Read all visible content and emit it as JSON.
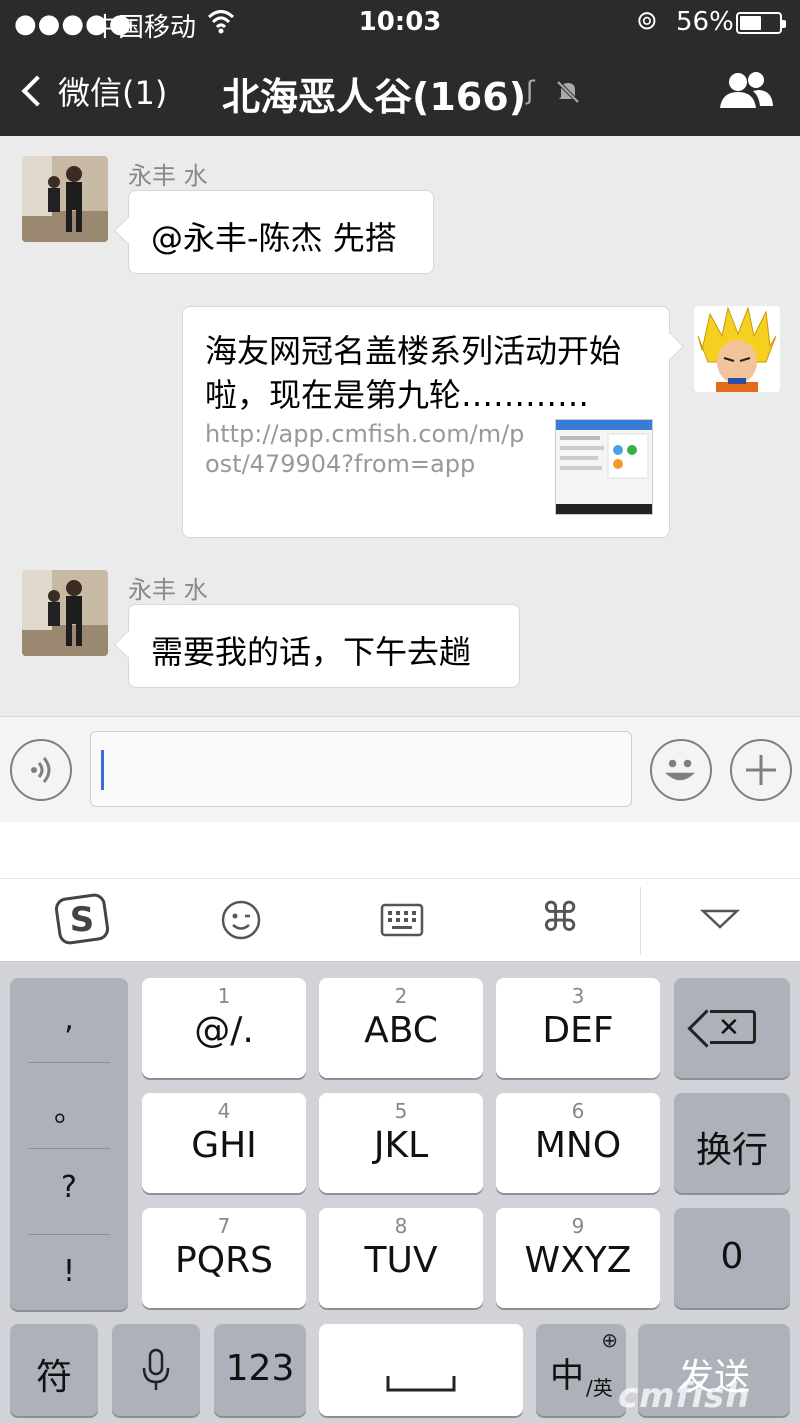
{
  "status_bar": {
    "signal": "●●●●●",
    "carrier": "中国移动",
    "wifi_icon": "wifi-icon",
    "time": "10:03",
    "lock_icon": "orientation-lock-icon",
    "battery_pct": "56%",
    "battery_level": 0.56
  },
  "nav": {
    "back_label": "微信(1)",
    "title": "北海恶人谷(166)",
    "ear_icon": "earpiece-icon",
    "mute_icon": "muted-bell-icon",
    "group_icon": "group-members-icon"
  },
  "messages": [
    {
      "side": "left",
      "sender": "永丰  水",
      "text": "@永丰-陈杰 先搭"
    },
    {
      "side": "right",
      "type": "link",
      "title": "海友网冠名盖楼系列活动开始啦，现在是第九轮…………",
      "url": "http://app.cmfish.com/m/post/479904?from=app"
    },
    {
      "side": "left",
      "sender": "永丰  水",
      "text": "需要我的话，下午去趟"
    }
  ],
  "input": {
    "voice_icon": "voice-input-icon",
    "emoji_icon": "emoji-icon",
    "plus_icon": "plus-icon",
    "value": ""
  },
  "keyboard_toolbar": {
    "items": [
      "sogou-logo-icon",
      "emoticon-icon",
      "keyboard-icon",
      "command-icon",
      "collapse-keyboard-icon"
    ]
  },
  "keyboard": {
    "punct": [
      ",",
      "。",
      "?",
      "!"
    ],
    "keys": [
      {
        "num": "1",
        "label": "@/."
      },
      {
        "num": "2",
        "label": "ABC"
      },
      {
        "num": "3",
        "label": "DEF"
      },
      {
        "num": "4",
        "label": "GHI"
      },
      {
        "num": "5",
        "label": "JKL"
      },
      {
        "num": "6",
        "label": "MNO"
      },
      {
        "num": "7",
        "label": "PQRS"
      },
      {
        "num": "8",
        "label": "TUV"
      },
      {
        "num": "9",
        "label": "WXYZ"
      }
    ],
    "newline": "换行",
    "zero": "0",
    "symbols": "符",
    "mic_icon": "microphone-icon",
    "numbers": "123",
    "space_icon": "space-bar-icon",
    "lang_main": "中",
    "lang_sub": "/英",
    "send": "发送",
    "delete_icon": "backspace-icon"
  },
  "watermark": "cmfish"
}
